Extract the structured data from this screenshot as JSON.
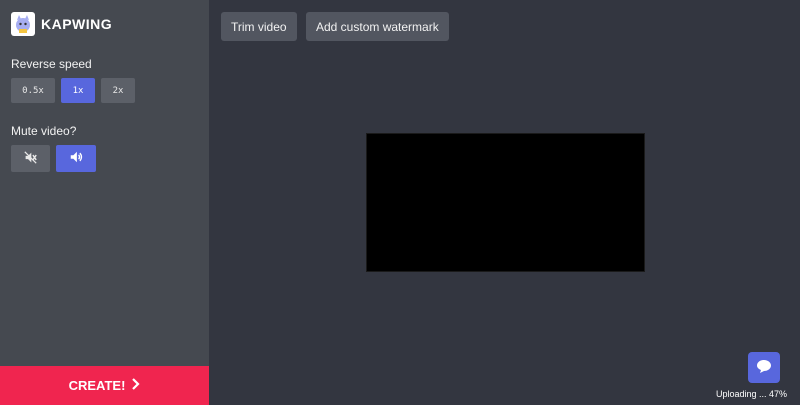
{
  "brand": {
    "name": "KAPWING"
  },
  "sidebar": {
    "reverse_speed_label": "Reverse speed",
    "speed_options": [
      {
        "label": "0.5x",
        "active": false
      },
      {
        "label": "1x",
        "active": true
      },
      {
        "label": "2x",
        "active": false
      }
    ],
    "mute_label": "Mute video?",
    "mute_options": [
      {
        "icon": "volume-mute-icon",
        "active": false
      },
      {
        "icon": "volume-up-icon",
        "active": true
      }
    ],
    "create_label": "CREATE!"
  },
  "toolbar": {
    "trim_label": "Trim video",
    "watermark_label": "Add custom watermark"
  },
  "status": {
    "uploading_text": "Uploading ... 47%"
  },
  "colors": {
    "accent": "#5867dd",
    "create": "#f0254f",
    "sidebar_bg": "#454950",
    "main_bg": "#333640"
  }
}
